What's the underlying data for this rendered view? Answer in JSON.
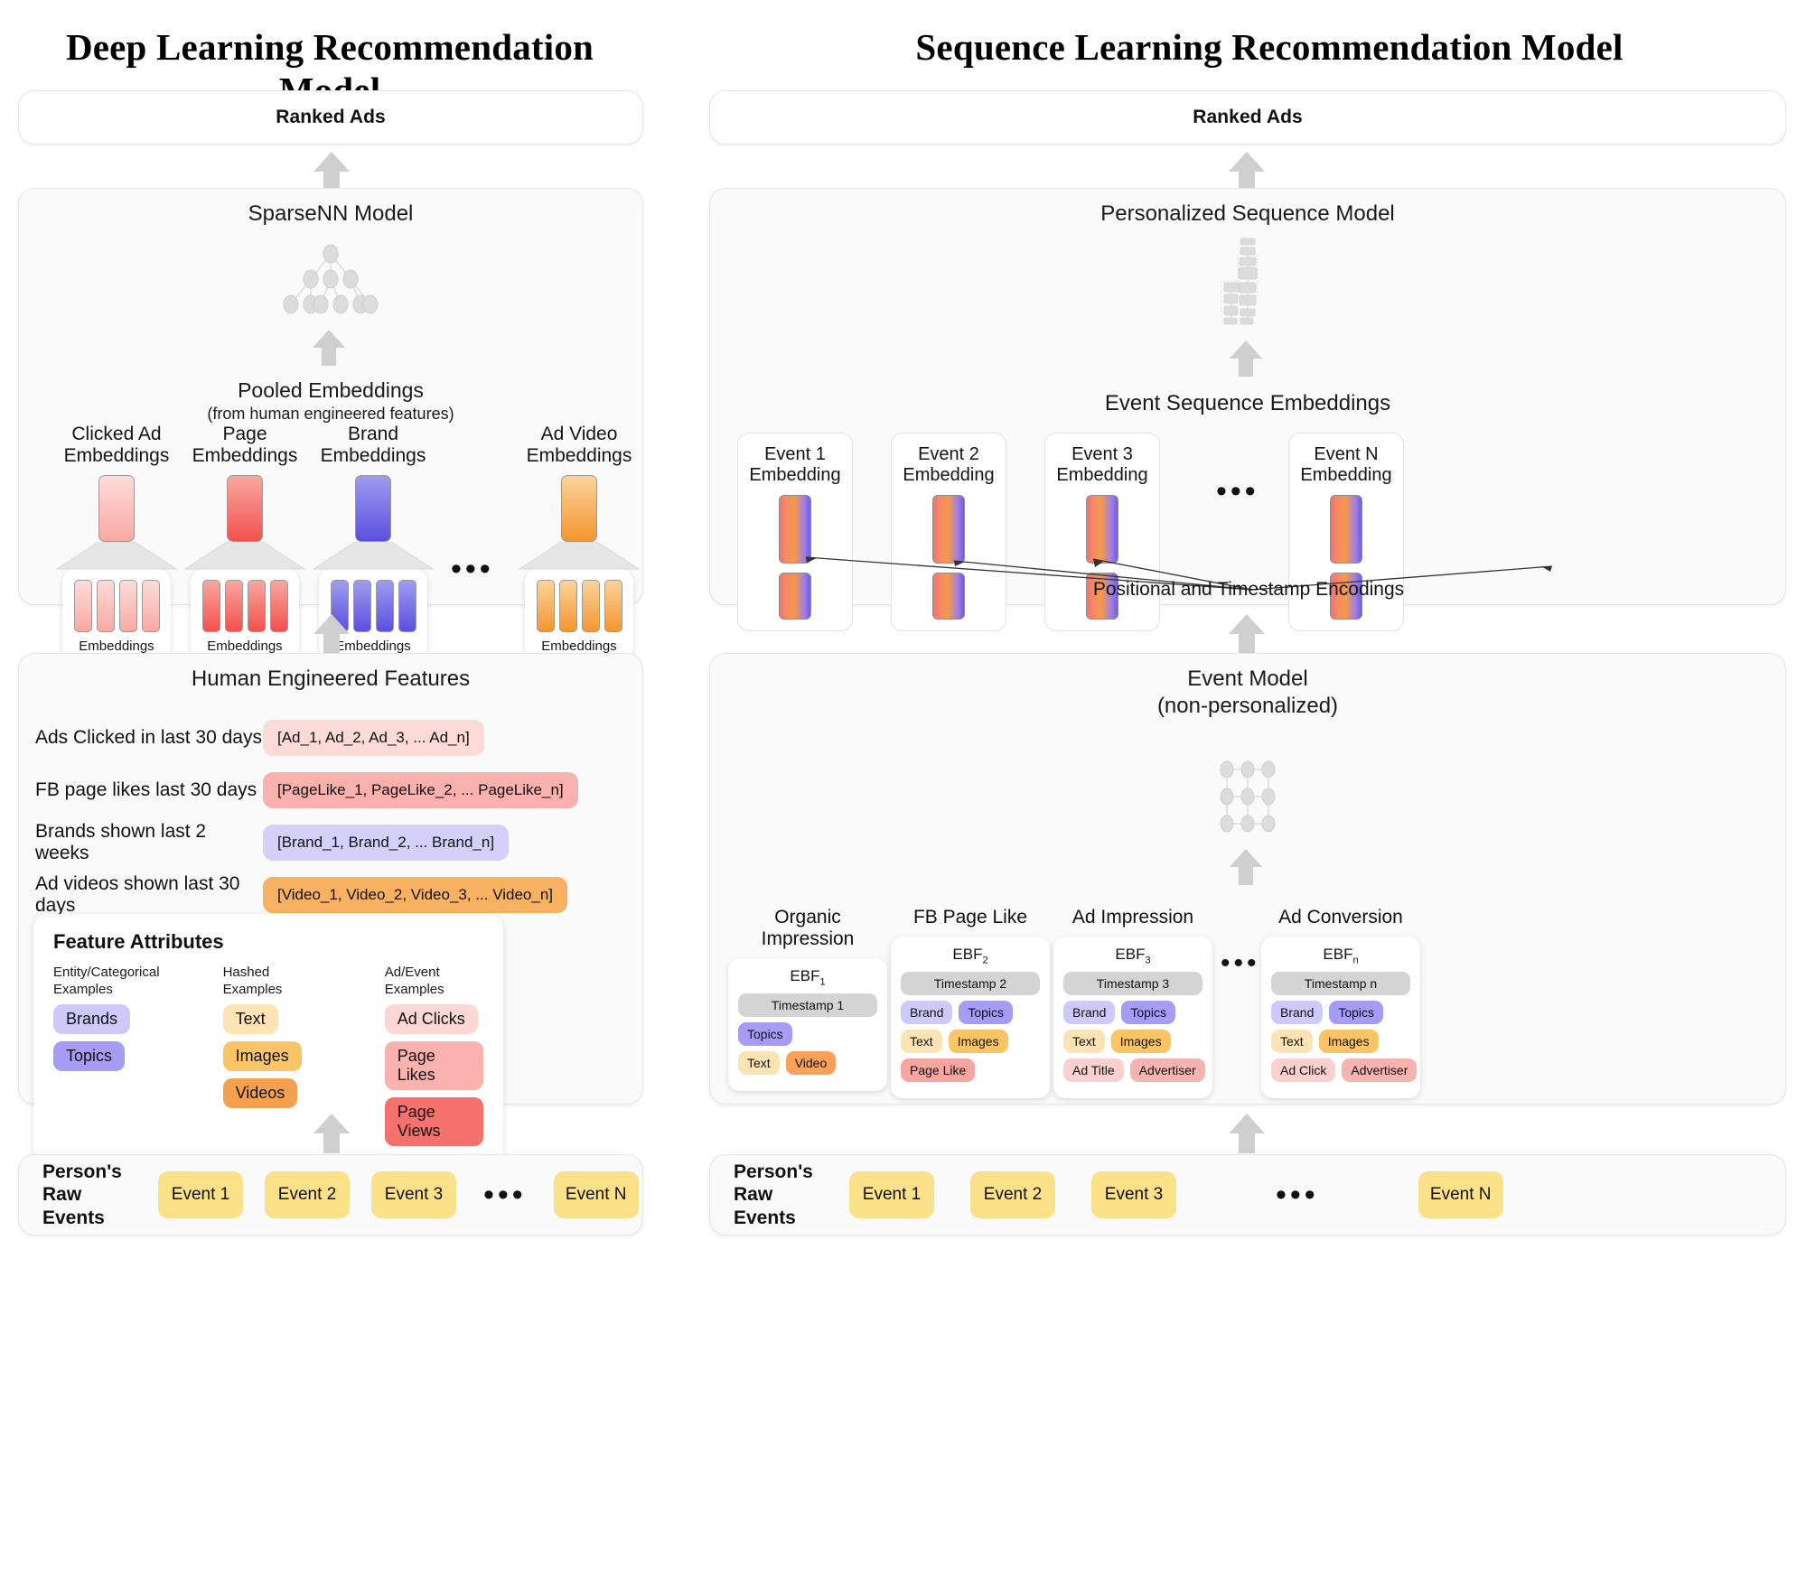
{
  "left": {
    "title": "Deep Learning Recommendation Model",
    "ranked_ads": "Ranked Ads",
    "model_title": "SparseNN Model",
    "pooled_title": "Pooled Embeddings",
    "pooled_sub": "(from human engineered features)",
    "embedding_columns": [
      {
        "caption": "Clicked Ad\nEmbeddings",
        "box_label": "Embeddings",
        "color_top": "#fddcd9",
        "color_bottom": "#f9a9a3"
      },
      {
        "caption": "Page\nEmbeddings",
        "box_label": "Embeddings",
        "color_top": "#f9a7a2",
        "color_bottom": "#f4504c"
      },
      {
        "caption": "Brand\nEmbeddings",
        "box_label": "Embeddings",
        "color_top": "#9f9cf0",
        "color_bottom": "#5a4fe0"
      },
      {
        "caption": "Ad Video\nEmbeddings",
        "box_label": "Embeddings",
        "color_top": "#fbd39a",
        "color_bottom": "#f5962f"
      }
    ],
    "ellipsis": "•••",
    "hef_title": "Human Engineered Features",
    "hef_rows": [
      {
        "label": "Ads Clicked in last 30 days",
        "value": "[Ad_1, Ad_2, Ad_3, ... Ad_n]",
        "bg": "#fbdad7"
      },
      {
        "label": "FB page likes last 30 days",
        "value": "[PageLike_1, PageLike_2, ... PageLike_n]",
        "bg": "#f9b1ad"
      },
      {
        "label": "Brands shown last 2 weeks",
        "value": "[Brand_1, Brand_2, ... Brand_n]",
        "bg": "#d4d0fa"
      },
      {
        "label": "Ad videos shown last 30 days",
        "value": "[Video_1, Video_2, Video_3, ... Video_n]",
        "bg": "#f8b061"
      }
    ],
    "feature_attributes": {
      "title": "Feature Attributes",
      "columns": [
        {
          "header": "Entity/Categorical\nExamples",
          "tags": [
            {
              "label": "Brands",
              "bg": "#cdc9fa"
            },
            {
              "label": "Topics",
              "bg": "#a49cf5"
            }
          ]
        },
        {
          "header": "Hashed Examples",
          "tags": [
            {
              "label": "Text",
              "bg": "#fce4b4"
            },
            {
              "label": "Images",
              "bg": "#fbc464"
            },
            {
              "label": "Videos",
              "bg": "#f5a04f"
            }
          ]
        },
        {
          "header": "Ad/Event\nExamples",
          "tags": [
            {
              "label": "Ad Clicks",
              "bg": "#fbd8d6"
            },
            {
              "label": "Page Likes",
              "bg": "#f9b2ae"
            },
            {
              "label": "Page Views",
              "bg": "#f4716d"
            }
          ]
        }
      ]
    },
    "raw_events": {
      "title": "Person's Raw\nEvents",
      "events": [
        "Event 1",
        "Event 2",
        "Event 3",
        "Event N"
      ],
      "ellipsis": "•••"
    }
  },
  "right": {
    "title": "Sequence Learning Recommendation Model",
    "ranked_ads": "Ranked Ads",
    "model_title": "Personalized Sequence Model",
    "seq_emb_title": "Event Sequence Embeddings",
    "event_cards": [
      {
        "caption": "Event 1\nEmbedding"
      },
      {
        "caption": "Event 2\nEmbedding"
      },
      {
        "caption": "Event 3\nEmbedding"
      },
      {
        "caption": "Event N\nEmbedding"
      }
    ],
    "ellipsis": "•••",
    "positional_label": "Positional and Timestamp Encodings",
    "event_model_title": "Event Model",
    "event_model_sub": "(non-personalized)",
    "ebf_columns": [
      {
        "header": "Organic Impression",
        "name": "EBF",
        "sub": "1",
        "rows": [
          [
            {
              "label": "Timestamp 1",
              "bg": "#d4d4d4",
              "full": true
            }
          ],
          [
            {
              "label": "Topics",
              "bg": "#a49cf5"
            }
          ],
          [
            {
              "label": "Text",
              "bg": "#fce4b4"
            },
            {
              "label": "Video",
              "bg": "#f8a15b"
            }
          ]
        ]
      },
      {
        "header": "FB Page Like",
        "name": "EBF",
        "sub": "2",
        "rows": [
          [
            {
              "label": "Timestamp 2",
              "bg": "#d4d4d4",
              "full": true
            }
          ],
          [
            {
              "label": "Brand",
              "bg": "#cdc9fa"
            },
            {
              "label": "Topics",
              "bg": "#a49cf5"
            }
          ],
          [
            {
              "label": "Text",
              "bg": "#fce4b4"
            },
            {
              "label": "Images",
              "bg": "#fbc464"
            }
          ],
          [
            {
              "label": "Page Like",
              "bg": "#f7a5a1"
            }
          ]
        ]
      },
      {
        "header": "Ad Impression",
        "name": "EBF",
        "sub": "3",
        "rows": [
          [
            {
              "label": "Timestamp 3",
              "bg": "#d4d4d4",
              "full": true
            }
          ],
          [
            {
              "label": "Brand",
              "bg": "#cdc9fa"
            },
            {
              "label": "Topics",
              "bg": "#a49cf5"
            }
          ],
          [
            {
              "label": "Text",
              "bg": "#fce4b4"
            },
            {
              "label": "Images",
              "bg": "#fbc464"
            }
          ],
          [
            {
              "label": "Ad Title",
              "bg": "#fbd0ce"
            },
            {
              "label": "Advertiser",
              "bg": "#f6b3b0"
            }
          ]
        ]
      },
      {
        "header": "Ad Conversion",
        "name": "EBF",
        "sub": "n",
        "rows": [
          [
            {
              "label": "Timestamp n",
              "bg": "#d4d4d4",
              "full": true
            }
          ],
          [
            {
              "label": "Brand",
              "bg": "#cdc9fa"
            },
            {
              "label": "Topics",
              "bg": "#a49cf5"
            }
          ],
          [
            {
              "label": "Text",
              "bg": "#fce4b4"
            },
            {
              "label": "Images",
              "bg": "#fbc464"
            }
          ],
          [
            {
              "label": "Ad Click",
              "bg": "#fbd0ce"
            },
            {
              "label": "Advertiser",
              "bg": "#f6b3b0"
            }
          ]
        ]
      }
    ],
    "ebf_ellipsis": "•••",
    "raw_events": {
      "title": "Person's Raw\nEvents",
      "events": [
        "Event 1",
        "Event 2",
        "Event 3",
        "Event N"
      ],
      "ellipsis": "•••"
    }
  }
}
